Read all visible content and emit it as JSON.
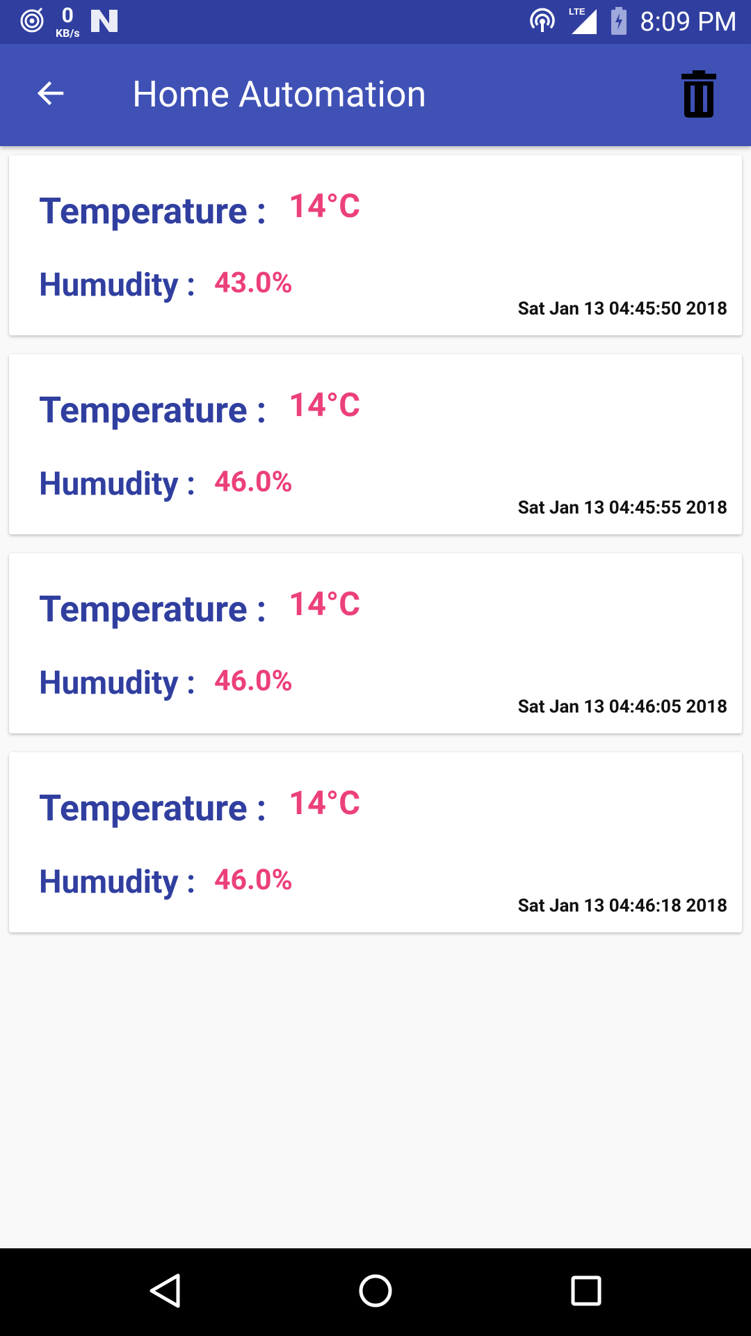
{
  "status_bar": {
    "network_speed_value": "0",
    "network_speed_unit": "KB/s",
    "network_type": "LTE",
    "time": "8:09 PM",
    "icons": [
      "cast-icon",
      "n-icon",
      "hotspot-icon",
      "signal-icon",
      "battery-icon"
    ]
  },
  "app_bar": {
    "title": "Home Automation",
    "back_icon": "arrow-back-icon",
    "delete_icon": "trash-icon"
  },
  "cards": [
    {
      "temperature_label": "Temperature :",
      "temperature_value": "14°C",
      "humidity_label": "Humudity :",
      "humidity_value": "43.0%",
      "timestamp": "Sat Jan 13 04:45:50 2018"
    },
    {
      "temperature_label": "Temperature :",
      "temperature_value": "14°C",
      "humidity_label": "Humudity :",
      "humidity_value": "46.0%",
      "timestamp": "Sat Jan 13 04:45:55 2018"
    },
    {
      "temperature_label": "Temperature :",
      "temperature_value": "14°C",
      "humidity_label": "Humudity :",
      "humidity_value": "46.0%",
      "timestamp": "Sat Jan 13 04:46:05 2018"
    },
    {
      "temperature_label": "Temperature :",
      "temperature_value": "14°C",
      "humidity_label": "Humudity :",
      "humidity_value": "46.0%",
      "timestamp": "Sat Jan 13 04:46:18 2018"
    }
  ],
  "nav_bar": {
    "icons": [
      "nav-back-icon",
      "nav-home-icon",
      "nav-recents-icon"
    ]
  },
  "colors": {
    "status_bar": "#303f9f",
    "app_bar": "#3f51b5",
    "label": "#303f9f",
    "value": "#ec407a",
    "background": "#f9f9f9"
  }
}
